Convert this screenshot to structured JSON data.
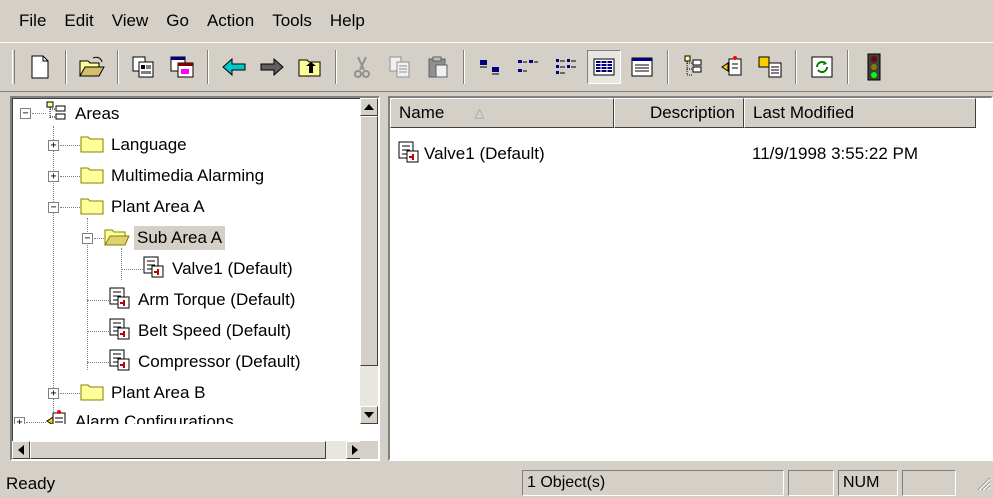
{
  "menu": [
    "File",
    "Edit",
    "View",
    "Go",
    "Action",
    "Tools",
    "Help"
  ],
  "toolbar": {
    "buttons": [
      "new-icon",
      "open-icon",
      "properties-icon",
      "new-window-icon",
      "back-icon",
      "forward-icon",
      "up-folder-icon",
      "cut-icon",
      "copy-icon",
      "paste-icon",
      "large-icons-icon",
      "small-icons-icon",
      "list-icon",
      "details-icon",
      "report-icon",
      "tree-icon",
      "alarm-icon",
      "alarm-list-icon",
      "refresh-icon",
      "traffic-light-icon"
    ],
    "pressed": "details-icon"
  },
  "tree": {
    "root": "Areas",
    "items": [
      {
        "label": "Language"
      },
      {
        "label": "Multimedia Alarming"
      },
      {
        "label": "Plant Area A"
      },
      {
        "label": "Sub Area A"
      },
      {
        "label": "Valve1 (Default)"
      },
      {
        "label": "Arm Torque (Default)"
      },
      {
        "label": "Belt Speed (Default)"
      },
      {
        "label": "Compressor (Default)"
      },
      {
        "label": "Plant Area B"
      },
      {
        "label": "Alarm Configurations"
      }
    ],
    "selected": "Sub Area A"
  },
  "list": {
    "columns": [
      "Name",
      "Description",
      "Last Modified"
    ],
    "rows": [
      {
        "name": "Valve1 (Default)",
        "description": "",
        "modified": "11/9/1998 3:55:22 PM"
      }
    ]
  },
  "status": {
    "text": "Ready",
    "count": "1 Object(s)",
    "num": "NUM"
  },
  "colors": {
    "face": "#d4d0c8",
    "folder": "#ffff99",
    "arrow": "#00c8c8"
  }
}
